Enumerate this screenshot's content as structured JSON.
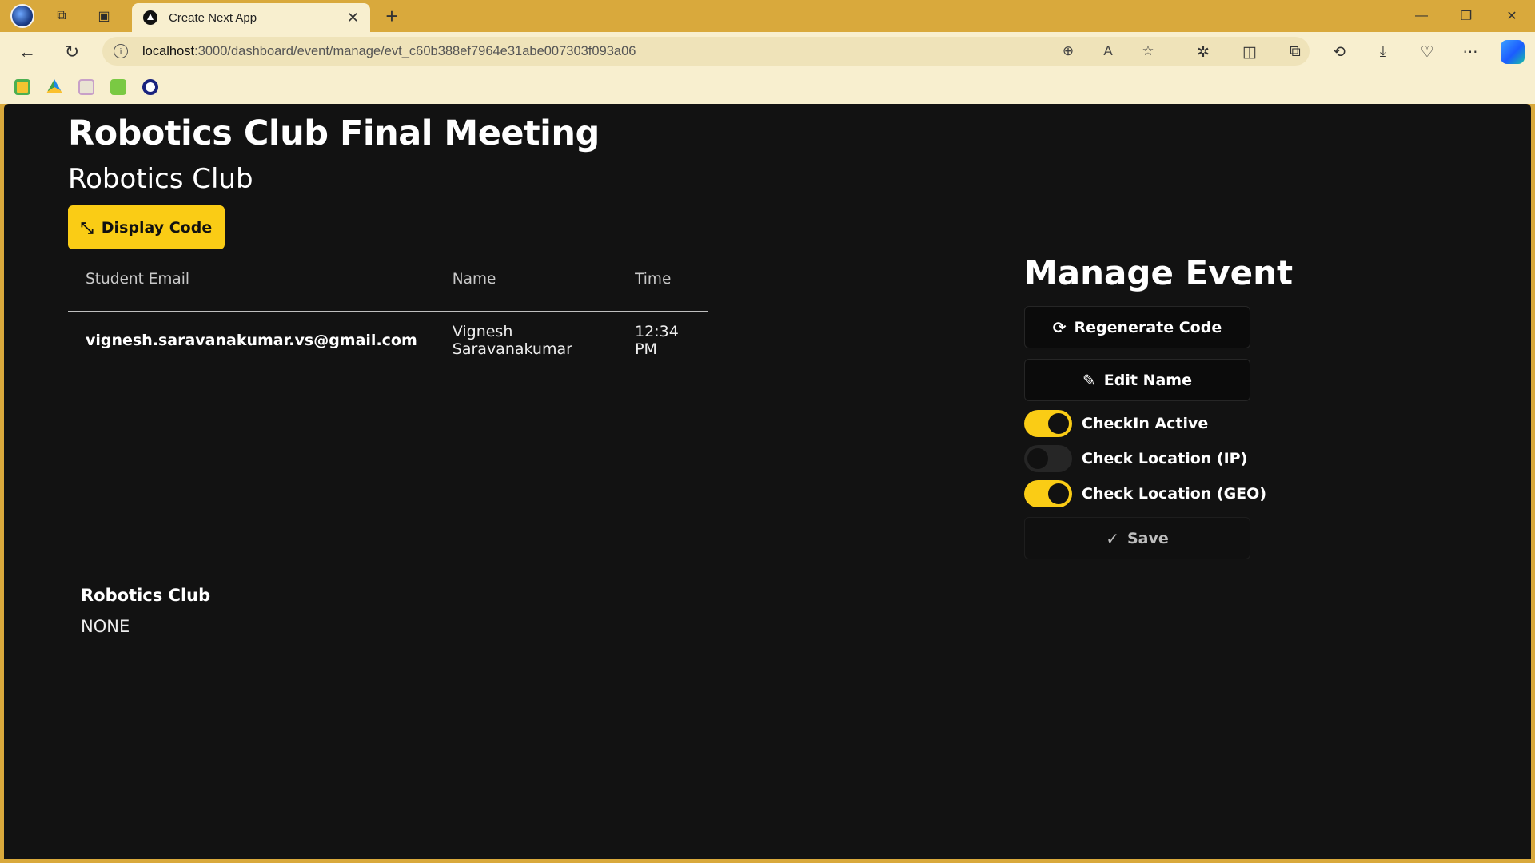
{
  "browser": {
    "tab_title": "Create Next App",
    "url_host": "localhost",
    "url_path": ":3000/dashboard/event/manage/evt_c60b388ef7964e31abe007303f093a06",
    "colors": {
      "frame": "#d9a93c",
      "toolbar": "#f8efcf"
    }
  },
  "event": {
    "title": "Robotics Club Final Meeting",
    "club": "Robotics Club",
    "display_code_label": "Display Code"
  },
  "table": {
    "headers": [
      "Student Email",
      "Name",
      "Time"
    ],
    "rows": [
      {
        "email": "vignesh.saravanakumar.vs@gmail.com",
        "name": "Vignesh Saravanakumar",
        "time": "12:34 PM"
      }
    ]
  },
  "footer": {
    "club": "Robotics Club",
    "value": "NONE"
  },
  "manage": {
    "title": "Manage Event",
    "regenerate_label": "Regenerate Code",
    "edit_label": "Edit Name",
    "save_label": "Save",
    "toggles": [
      {
        "label": "CheckIn Active",
        "on": true
      },
      {
        "label": "Check Location (IP)",
        "on": false
      },
      {
        "label": "Check Location (GEO)",
        "on": true
      }
    ]
  },
  "colors": {
    "accent": "#facc15",
    "background": "#121212"
  }
}
